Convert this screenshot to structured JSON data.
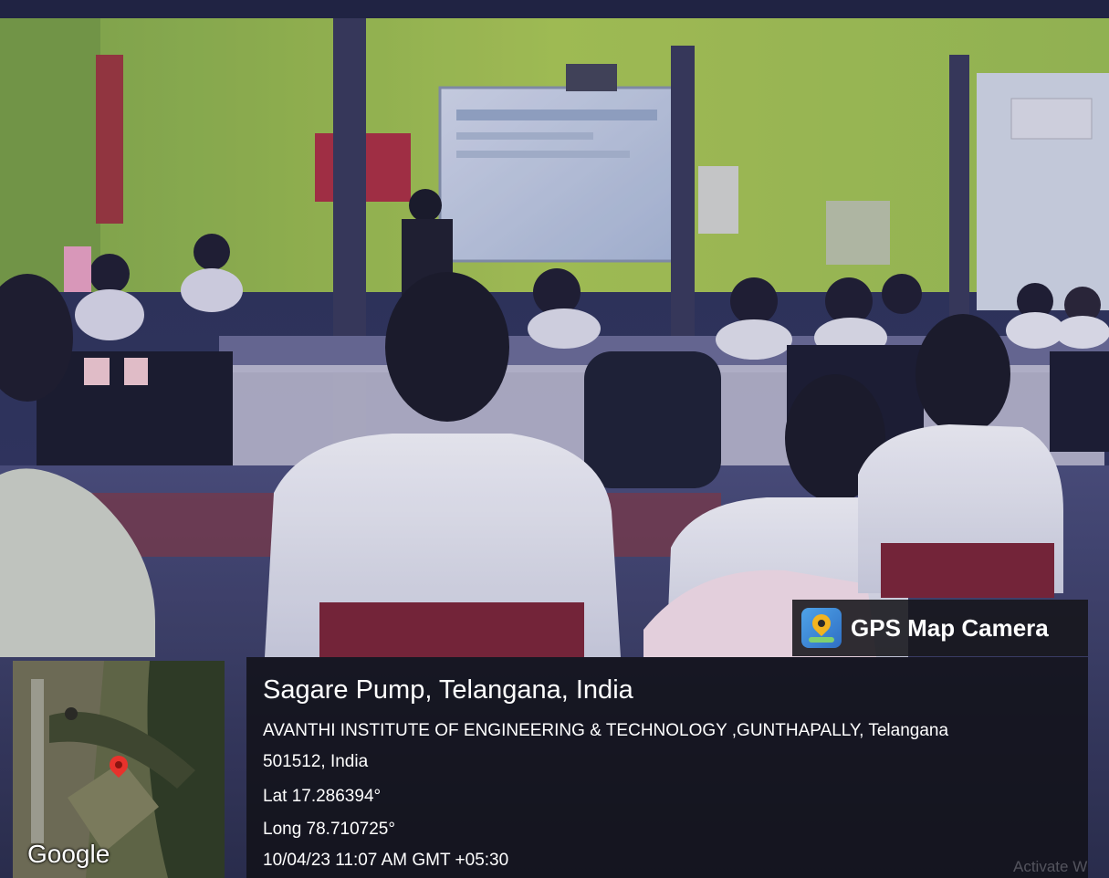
{
  "scene": {
    "description_icons": [
      "photo-background",
      "projector-screen",
      "student-figures",
      "computer-monitors"
    ],
    "colors": {
      "wall_green": "#a9cf38",
      "glass_tint": "#6d6fb4",
      "shirt_white": "#e8e8f2",
      "chair_maroon": "#7a2336",
      "overlay_dark": "#16161a"
    }
  },
  "gps_badge": {
    "title": "GPS Map Camera",
    "icon": "gps-map-camera-app-icon"
  },
  "minimap": {
    "brand": "Google",
    "icon": "location-pin-icon",
    "pin_color": "#e8322c"
  },
  "location": {
    "title": "Sagare Pump, Telangana, India",
    "address_line1": "AVANTHI INSTITUTE OF ENGINEERING & TECHNOLOGY ,GUNTHAPALLY, Telangana",
    "address_line2": "501512, India",
    "latitude": "Lat 17.286394°",
    "longitude": "Long 78.710725°",
    "timestamp": "10/04/23 11:07 AM GMT +05:30"
  },
  "watermark": "Activate W"
}
